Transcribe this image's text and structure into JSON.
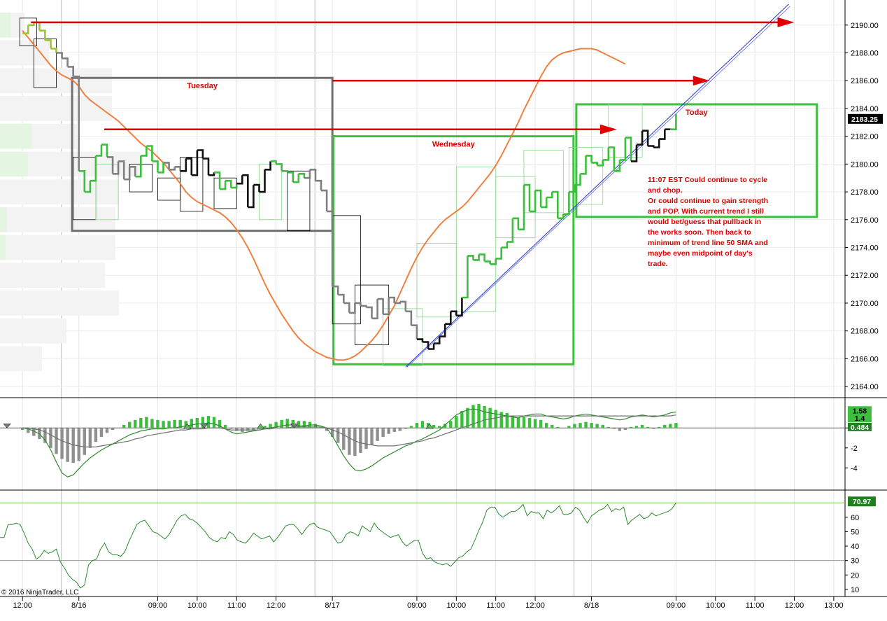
{
  "chart_data": {
    "type": "line",
    "instrument_note": "",
    "copyright": "© 2016 NinjaTrader, LLC",
    "x_ticks": [
      {
        "i": 0,
        "label": "12:00"
      },
      {
        "i": 10,
        "label": "8/16"
      },
      {
        "i": 24,
        "label": "09:00"
      },
      {
        "i": 31,
        "label": "10:00"
      },
      {
        "i": 38,
        "label": "11:00"
      },
      {
        "i": 45,
        "label": "12:00"
      },
      {
        "i": 55,
        "label": "8/17"
      },
      {
        "i": 70,
        "label": "09:00"
      },
      {
        "i": 77,
        "label": "10:00"
      },
      {
        "i": 84,
        "label": "11:00"
      },
      {
        "i": 91,
        "label": "12:00"
      },
      {
        "i": 101,
        "label": "8/18"
      },
      {
        "i": 116,
        "label": "09:00"
      },
      {
        "i": 123,
        "label": "10:00"
      },
      {
        "i": 130,
        "label": "11:00"
      },
      {
        "i": 137,
        "label": "12:00"
      },
      {
        "i": 144,
        "label": "13:00"
      }
    ],
    "x_index_range": [
      -4,
      146
    ],
    "panels": [
      {
        "name": "price",
        "ylim": [
          2163.5,
          2191.5
        ],
        "ticks": [
          "2164.00",
          "2166.00",
          "2168.00",
          "2170.00",
          "2172.00",
          "2174.00",
          "2176.00",
          "2178.00",
          "2180.00",
          "2182.00",
          "2184.00",
          "2186.00",
          "2188.00",
          "2190.00"
        ],
        "last_value": "2183.25",
        "price_series": [
          2189.4,
          2190.0,
          2190.2,
          2189.6,
          2188.9,
          2188.3,
          2188.0,
          2187.6,
          2187.0,
          2186.3,
          2179.5,
          2178.0,
          2178.8,
          2180.6,
          2181.4,
          2180.5,
          2179.3,
          2180.2,
          2178.9,
          2179.8,
          2179.1,
          2180.6,
          2181.3,
          2180.2,
          2179.4,
          2180.1,
          2179.6,
          2179.8,
          2179.5,
          2180.4,
          2179.2,
          2181.0,
          2180.4,
          2179.2,
          2179.4,
          2178.2,
          2178.8,
          2178.3,
          2178.6,
          2179.2,
          2176.9,
          2178.5,
          2178.0,
          2179.6,
          2180.2,
          2180.0,
          2179.5,
          2179.4,
          2178.7,
          2179.3,
          2179.0,
          2179.6,
          2178.8,
          2178.1,
          2176.6,
          2171.2,
          2170.6,
          2170.0,
          2169.3,
          2170.0,
          2169.8,
          2169.7,
          2168.9,
          2170.3,
          2169.2,
          2170.4,
          2170.0,
          2170.1,
          2169.4,
          2168.4,
          2167.4,
          2167.2,
          2166.7,
          2167.1,
          2167.6,
          2168.5,
          2169.4,
          2169.1,
          2170.4,
          2173.4,
          2173.1,
          2173.5,
          2173.0,
          2172.8,
          2173.2,
          2174.0,
          2174.4,
          2176.1,
          2175.3,
          2178.5,
          2176.6,
          2178.1,
          2176.9,
          2177.6,
          2178.0,
          2176.1,
          2176.4,
          2178.0,
          2178.5,
          2179.3,
          2180.6,
          2180.1,
          2179.9,
          2180.3,
          2181.2,
          2179.5,
          2180.3,
          2181.9,
          2180.2,
          2181.4,
          2182.4,
          2181.3,
          2181.2,
          2181.8,
          2182.5,
          2182.5,
          2183.6
        ],
        "price_colors": "ggggggkkkkgggggkkkkkgggggkkkkkkkkkggggkkkkkkggggggkkkkkkkkkkkkkkkkkkkkkkkkkkkkggggggggggggggggggggggggggggggkkkkkkkggggkkkk",
        "sma_label": "50 SMA",
        "sma_series": [
          2189.6,
          2189.1,
          2188.6,
          2188.1,
          2187.6,
          2187.1,
          2186.7,
          2186.4,
          2186.2,
          2186.0,
          2185.6,
          2185.0,
          2184.6,
          2184.3,
          2184.0,
          2183.7,
          2183.4,
          2183.1,
          2182.7,
          2182.3,
          2181.9,
          2181.5,
          2181.2,
          2180.9,
          2180.5,
          2180.1,
          2179.6,
          2179.1,
          2178.6,
          2178.0,
          2177.6,
          2177.3,
          2177.1,
          2176.9,
          2176.7,
          2176.5,
          2176.2,
          2175.8,
          2175.3,
          2174.7,
          2174.0,
          2173.2,
          2172.3,
          2171.4,
          2170.6,
          2169.9,
          2169.2,
          2168.6,
          2168.0,
          2167.5,
          2167.1,
          2166.8,
          2166.5,
          2166.3,
          2166.1,
          2166.0,
          2165.9,
          2165.9,
          2166.0,
          2166.2,
          2166.5,
          2166.9,
          2167.3,
          2167.8,
          2168.4,
          2169.1,
          2169.8,
          2170.7,
          2171.6,
          2172.5,
          2173.3,
          2174.0,
          2174.6,
          2175.1,
          2175.6,
          2176.0,
          2176.3,
          2176.6,
          2176.9,
          2177.3,
          2177.8,
          2178.3,
          2178.8,
          2179.3,
          2179.9,
          2180.6,
          2181.4,
          2182.2,
          2183.0,
          2183.9,
          2184.7,
          2185.5,
          2186.3,
          2187.0,
          2187.5,
          2187.8,
          2188.0,
          2188.1,
          2188.2,
          2188.3,
          2188.3,
          2188.3,
          2188.2,
          2188.0,
          2187.8,
          2187.6,
          2187.4,
          2187.2
        ],
        "boxes": [
          {
            "label": "Tuesday",
            "i0": 8.8,
            "i1": 55.0,
            "top": 2186.2,
            "bottom": 2175.2,
            "color": "#707070"
          },
          {
            "label": "Wednesday",
            "i0": 55.2,
            "i1": 97.8,
            "top": 2182.0,
            "bottom": 2165.6,
            "color": "#3cbf3c"
          },
          {
            "label": "Today",
            "i0": 98.3,
            "i1": 141.0,
            "top": 2184.3,
            "bottom": 2176.2,
            "color": "#3cbf3c"
          }
        ],
        "arrows": [
          {
            "i0": 1.5,
            "i1": 137.0,
            "y": 2190.2
          },
          {
            "i0": 55.0,
            "i1": 122.0,
            "y": 2186.0
          },
          {
            "i0": 14.5,
            "i1": 105.5,
            "y": 2182.5
          }
        ],
        "trendline": {
          "i0": 68.0,
          "y0": 2165.4,
          "i1": 136.0,
          "y1": 2191.5
        },
        "annotation": [
          "11:07 EST Could continue to cycle",
          "and chop.",
          "Or could continue to gain strength",
          "and POP.  With current trend I still",
          "would bet/guess that pullback in",
          "the works soon.  Then back to",
          "minimum of trend line 50 SMA and",
          "maybe even midpoint of day's",
          "trade."
        ]
      },
      {
        "name": "macd",
        "ylim": [
          -5.8,
          2.4
        ],
        "ticks": [
          "-4",
          "-2",
          "0"
        ],
        "last_values": [
          "1.58",
          "1.4",
          "0.484"
        ],
        "histogram": [
          -0.2,
          -0.5,
          -0.8,
          -1.1,
          -1.5,
          -2.0,
          -2.6,
          -3.1,
          -3.4,
          -3.5,
          -3.3,
          -2.7,
          -2.0,
          -1.4,
          -0.9,
          -0.5,
          -0.2,
          0.0,
          0.3,
          0.6,
          0.8,
          1.0,
          1.1,
          0.9,
          0.8,
          0.7,
          0.7,
          0.8,
          0.8,
          0.7,
          0.9,
          1.0,
          1.1,
          1.2,
          1.1,
          0.8,
          0.3,
          -0.1,
          -0.3,
          -0.4,
          -0.3,
          -0.2,
          -0.1,
          0.2,
          0.4,
          0.6,
          0.8,
          0.9,
          0.8,
          0.7,
          0.7,
          0.6,
          0.4,
          0.1,
          -0.3,
          -0.9,
          -1.5,
          -2.2,
          -2.7,
          -2.8,
          -2.5,
          -2.1,
          -1.7,
          -1.3,
          -0.9,
          -0.6,
          -0.4,
          -0.3,
          -0.1,
          0.2,
          0.5,
          0.7,
          0.5,
          0.3,
          0.2,
          0.4,
          0.7,
          1.2,
          1.7,
          2.0,
          2.3,
          2.4,
          2.2,
          2.0,
          1.8,
          1.6,
          1.5,
          1.2,
          1.0,
          1.1,
          1.0,
          0.9,
          0.8,
          0.5,
          0.3,
          0.1,
          0.0,
          0.2,
          0.4,
          0.5,
          0.6,
          0.5,
          0.4,
          0.3,
          0.1,
          -0.1,
          -0.3,
          -0.2,
          0.1,
          0.2,
          0.3,
          0.1,
          -0.1,
          0.1,
          0.3,
          0.4,
          0.5
        ],
        "fast": [
          0.0,
          -0.1,
          -0.3,
          -0.6,
          -1.2,
          -2.2,
          -3.4,
          -4.5,
          -4.9,
          -4.7,
          -4.1,
          -3.5,
          -3.0,
          -2.6,
          -2.2,
          -1.9,
          -1.6,
          -1.3,
          -1.0,
          -0.7,
          -0.5,
          -0.3,
          -0.2,
          -0.1,
          -0.1,
          -0.1,
          0.0,
          0.0,
          0.1,
          0.2,
          0.3,
          0.4,
          0.4,
          0.5,
          0.4,
          0.2,
          -0.1,
          -0.4,
          -0.6,
          -0.5,
          -0.4,
          -0.3,
          -0.2,
          -0.1,
          0.0,
          0.1,
          0.2,
          0.3,
          0.3,
          0.2,
          0.2,
          0.3,
          0.3,
          0.2,
          0.0,
          -0.8,
          -1.8,
          -2.8,
          -3.6,
          -4.2,
          -4.3,
          -4.1,
          -3.8,
          -3.4,
          -3.0,
          -2.7,
          -2.4,
          -2.1,
          -1.8,
          -1.6,
          -1.3,
          -1.1,
          -0.8,
          -0.5,
          -0.2,
          0.3,
          0.8,
          1.3,
          1.6,
          1.8,
          1.9,
          1.8,
          1.6,
          1.5,
          1.4,
          1.3,
          1.2,
          1.1,
          1.0,
          1.2,
          1.3,
          1.4,
          1.4,
          1.2,
          1.1,
          1.0,
          0.9,
          1.0,
          1.2,
          1.3,
          1.4,
          1.3,
          1.2,
          1.1,
          1.0,
          0.9,
          0.8,
          0.9,
          1.1,
          1.2,
          1.3,
          1.2,
          1.1,
          1.2,
          1.3,
          1.5,
          1.6
        ],
        "slow": [
          0.0,
          0.0,
          -0.1,
          -0.2,
          -0.4,
          -0.7,
          -1.0,
          -1.3,
          -1.5,
          -1.7,
          -1.8,
          -1.9,
          -1.9,
          -1.9,
          -1.8,
          -1.7,
          -1.6,
          -1.5,
          -1.4,
          -1.3,
          -1.1,
          -1.0,
          -0.8,
          -0.7,
          -0.6,
          -0.5,
          -0.4,
          -0.3,
          -0.2,
          -0.2,
          -0.1,
          -0.1,
          -0.1,
          0.0,
          0.0,
          0.0,
          -0.1,
          -0.2,
          -0.2,
          -0.2,
          -0.2,
          -0.2,
          -0.2,
          -0.1,
          -0.1,
          0.0,
          0.0,
          0.0,
          0.1,
          0.1,
          0.1,
          0.1,
          0.1,
          0.1,
          0.0,
          -0.2,
          -0.4,
          -0.7,
          -1.0,
          -1.3,
          -1.5,
          -1.6,
          -1.7,
          -1.8,
          -1.8,
          -1.8,
          -1.8,
          -1.7,
          -1.6,
          -1.5,
          -1.4,
          -1.3,
          -1.1,
          -1.0,
          -0.8,
          -0.6,
          -0.4,
          -0.2,
          0.0,
          0.2,
          0.4,
          0.6,
          0.8,
          0.9,
          1.0,
          1.1,
          1.2,
          1.2,
          1.2,
          1.2,
          1.2,
          1.2,
          1.2,
          1.2,
          1.2,
          1.2,
          1.2,
          1.2,
          1.2,
          1.2,
          1.2,
          1.2,
          1.2,
          1.2,
          1.2,
          1.2,
          1.2,
          1.2,
          1.2,
          1.2,
          1.2,
          1.2,
          1.2,
          1.2,
          1.2,
          1.2,
          1.3
        ],
        "markers": [
          {
            "i": 0,
            "dir": "down"
          },
          {
            "i": 32,
            "dir": "up"
          },
          {
            "i": 35,
            "dir": "down"
          },
          {
            "i": 45,
            "dir": "up"
          },
          {
            "i": 51,
            "dir": "down"
          },
          {
            "i": 75,
            "dir": "up"
          }
        ]
      },
      {
        "name": "rsi",
        "ylim": [
          8,
          74
        ],
        "ticks": [
          "10",
          "20",
          "30",
          "40",
          "50",
          "60"
        ],
        "levels": [
          30,
          70
        ],
        "last_value": "70.97",
        "series": [
          46,
          46,
          55,
          55,
          56,
          55,
          49,
          42,
          38,
          31,
          33,
          37,
          35,
          36,
          38,
          29,
          25,
          20,
          17,
          15,
          11,
          13,
          27,
          30,
          31,
          38,
          42,
          36,
          34,
          34,
          33,
          36,
          43,
          49,
          55,
          57,
          58,
          54,
          50,
          49,
          47,
          45,
          48,
          53,
          58,
          61,
          62,
          59,
          58,
          56,
          53,
          50,
          46,
          44,
          43,
          46,
          45,
          50,
          48,
          44,
          43,
          42,
          45,
          49,
          47,
          45,
          46,
          47,
          43,
          46,
          50,
          54,
          55,
          55,
          52,
          48,
          52,
          55,
          56,
          53,
          52,
          51,
          50,
          46,
          42,
          43,
          48,
          50,
          49,
          47,
          54,
          52,
          50,
          56,
          52,
          50,
          48,
          46,
          47,
          48,
          43,
          40,
          42,
          44,
          44,
          35,
          31,
          32,
          29,
          28,
          27,
          28,
          26,
          29,
          32,
          33,
          36,
          38,
          44,
          51,
          57,
          65,
          67,
          67,
          62,
          60,
          62,
          64,
          64,
          66,
          69,
          61,
          64,
          63,
          63,
          59,
          65,
          63,
          65,
          68,
          62,
          62,
          63,
          67,
          65,
          60,
          56,
          61,
          63,
          65,
          66,
          69,
          64,
          66,
          65,
          67,
          55,
          58,
          60,
          62,
          59,
          60,
          63,
          61,
          62,
          63,
          64,
          66,
          70
        ]
      }
    ]
  }
}
